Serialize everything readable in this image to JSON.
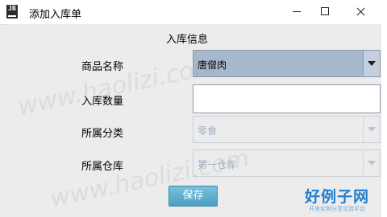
{
  "window": {
    "title": "添加入库单",
    "icon_text": "JB"
  },
  "form": {
    "heading": "入库信息",
    "product_name": {
      "label": "商品名称",
      "value": "唐僧肉"
    },
    "quantity": {
      "label": "入库数量",
      "value": ""
    },
    "category": {
      "label": "所属分类",
      "value": "零食"
    },
    "warehouse": {
      "label": "所属仓库",
      "value": "第一仓库"
    }
  },
  "actions": {
    "save_label": "保存"
  },
  "watermark": {
    "text": "www.haolizi.com",
    "logo_main": "好例子网",
    "logo_sub": "开发实例分享交流平台"
  },
  "colors": {
    "accent_button": "#4a9fc1",
    "combo_selected": "#a8b8cc"
  }
}
